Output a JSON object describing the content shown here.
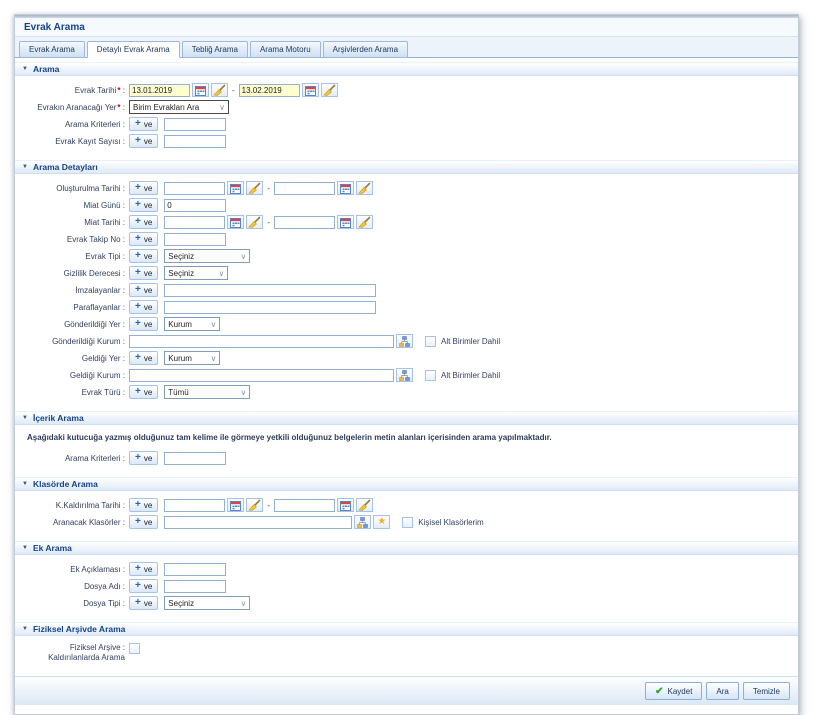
{
  "window_title": "Evrak Arama",
  "tabs": [
    "Evrak Arama",
    "Detaylı Evrak Arama",
    "Tebliğ Arama",
    "Arama Motoru",
    "Arşivlerden Arama"
  ],
  "common": {
    "ve": "ve",
    "dash": "-"
  },
  "arama": {
    "title": "Arama",
    "evrak_tarihi_label": "Evrak Tarihi",
    "evrak_tarihi_from": "13.01.2019",
    "evrak_tarihi_to": "13.02.2019",
    "aranacagi_yer_label": "Evrakın Aranacağı Yer",
    "aranacagi_yer_value": "Birim Evrakları Ara",
    "arama_kriterleri_label": "Arama Kriterleri",
    "evrak_kayit_sayisi_label": "Evrak Kayıt Sayısı"
  },
  "detaylar": {
    "title": "Arama Detayları",
    "olusturulma_tarihi_label": "Oluşturulma Tarihi",
    "miat_gunu_label": "Miat Günü",
    "miat_gunu_value": "0",
    "miat_tarihi_label": "Miat Tarihi",
    "evrak_takip_no_label": "Evrak Takip No",
    "evrak_tipi_label": "Evrak Tipi",
    "evrak_tipi_value": "Seçiniz",
    "gizlilik_derecesi_label": "Gizlilik Derecesi",
    "gizlilik_derecesi_value": "Seçiniz",
    "imzalayanlar_label": "İmzalayanlar",
    "paraflayanlar_label": "Paraflayanlar",
    "gonderildigi_yer_label": "Gönderildiği Yer",
    "gonderildigi_yer_value": "Kurum",
    "gonderildigi_kurum_label": "Gönderildiği Kurum",
    "alt_birimler_label": "Alt Birimler Dahil",
    "geldigi_yer_label": "Geldiği Yer",
    "geldigi_yer_value": "Kurum",
    "geldigi_kurum_label": "Geldiği Kurum",
    "evrak_turu_label": "Evrak Türü",
    "evrak_turu_value": "Tümü"
  },
  "icerik": {
    "title": "İçerik Arama",
    "description": "Aşağıdaki kutucuğa yazmış olduğunuz tam kelime ile görmeye yetkili olduğunuz belgelerin metin alanları içerisinden arama yapılmaktadır.",
    "arama_kriterleri_label": "Arama Kriterleri"
  },
  "klasor": {
    "title": "Klasörde Arama",
    "kaldirilma_tarihi_label": "K.Kaldırılma Tarihi",
    "aranacak_klasorler_label": "Aranacak Klasörler",
    "kisisel_klasorlerim_label": "Kişisel Klasörlerim"
  },
  "ek": {
    "title": "Ek Arama",
    "ek_aciklamasi_label": "Ek Açıklaması",
    "dosya_adi_label": "Dosya Adı",
    "dosya_tipi_label": "Dosya Tipi",
    "dosya_tipi_value": "Seçiniz"
  },
  "fiziksel": {
    "title": "Fiziksel Arşivde Arama",
    "label_line1": "Fiziksel Arşive",
    "label_line2": "Kaldırılanlarda Arama"
  },
  "footer": {
    "kaydet": "Kaydet",
    "ara": "Ara",
    "temizle": "Temizle"
  },
  "colors": {
    "accent_navy": "#15428b",
    "required_red": "#d40000",
    "date_filled_bg": "#ffffd0",
    "check_green": "#2ea52e",
    "star_yellow": "#f2b32a"
  }
}
